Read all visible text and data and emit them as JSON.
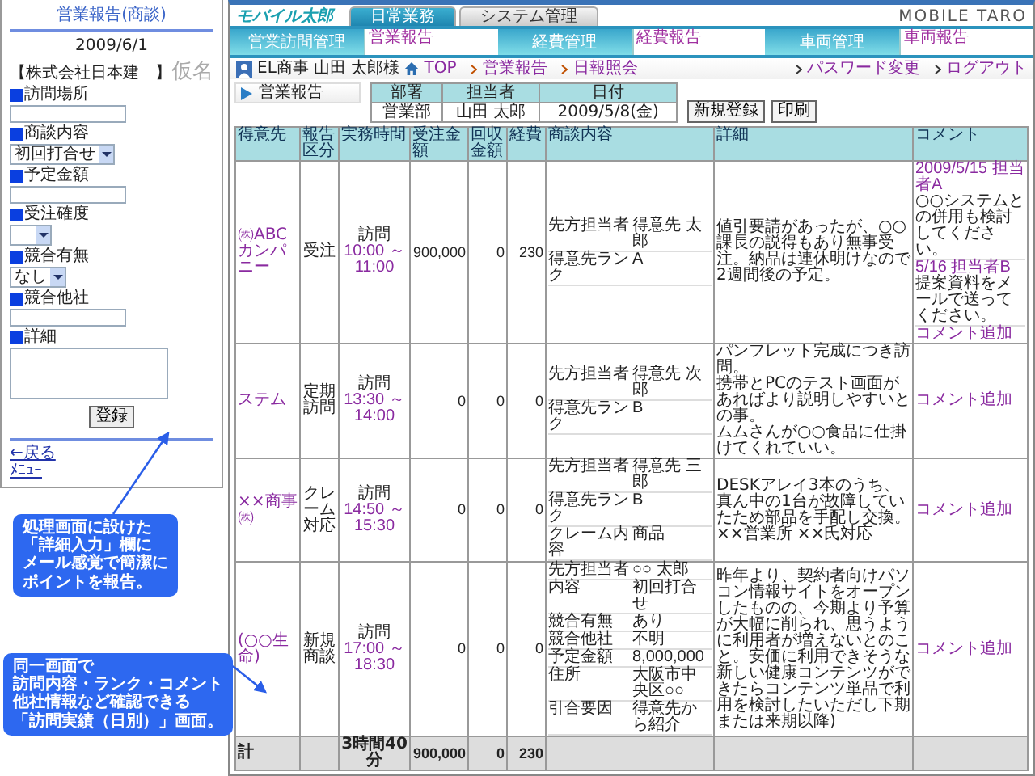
{
  "mobile_form": {
    "title": "営業報告(商談)",
    "date": "2009/6/1",
    "company": "【株式会社日本建　】",
    "kana": "仮名",
    "fields": [
      {
        "label": "訪問場所",
        "kind": "text"
      },
      {
        "label": "商談内容",
        "kind": "select",
        "value": "初回打合せ"
      },
      {
        "label": "予定金額",
        "kind": "text"
      },
      {
        "label": "受注確度",
        "kind": "select"
      },
      {
        "label": "競合有無",
        "kind": "select",
        "value": "なし"
      },
      {
        "label": "競合他社",
        "kind": "text"
      },
      {
        "label": "詳細",
        "kind": "textarea"
      }
    ],
    "submit": "登録",
    "links": [
      "←戻る",
      "ﾒﾆｭｰ"
    ]
  },
  "app": {
    "logo": "モバイル太郎",
    "brand": "MOBILE TARO",
    "tabs": [
      {
        "label": "日常業務",
        "selected": true
      },
      {
        "label": "システム管理",
        "selected": false
      }
    ],
    "menu": [
      {
        "heading": "営業訪問管理",
        "link": "営業報告"
      },
      {
        "heading": "経費管理",
        "link": "経費報告"
      },
      {
        "heading": "車両管理",
        "link": "車両報告"
      }
    ],
    "user": "EL商事 山田 太郎様",
    "top_link": "TOP",
    "account_links": [
      "パスワード変更",
      "ログアウト"
    ],
    "breadcrumb": [
      "営業報告",
      "日報照会"
    ],
    "section_title": "営業報告",
    "info": {
      "columns": [
        "部署",
        "担当者",
        "日付"
      ],
      "row": [
        "営業部",
        "山田 太郎",
        "2009/5/8(金)"
      ]
    },
    "buttons": [
      "新規登録",
      "印刷"
    ],
    "table": {
      "columns": [
        "得意先",
        "報告区分",
        "実務時間",
        "受注金額",
        "回収金額",
        "経費",
        "商談内容",
        "詳細",
        "コメント"
      ],
      "rows": [
        {
          "customer": "㈱ABCカンパニー",
          "type": "受注",
          "visit": "訪問",
          "time": "10:00 ～ 11:00",
          "order": "900,000",
          "collected": "0",
          "expense": "230",
          "pairs": [
            [
              "先方担当者",
              "得意先 太郎"
            ],
            [
              "得意先ランク",
              "A"
            ]
          ],
          "detail": [
            "値引要請があったが、○○課長の説得もあり無事受注。納品は連休明けなので2週間後の予定。"
          ],
          "comments": [
            {
              "date": "2009/5/15 担当者A",
              "text": "○○システムとの併用も検討してください。"
            },
            {
              "date": "5/16 担当者B",
              "text": "提案資料をメールで送ってください。"
            }
          ],
          "add": "コメント追加"
        },
        {
          "customer": "ステム",
          "type": "定期訪問",
          "visit": "訪問",
          "time": "13:30 ～ 14:00",
          "order": "0",
          "collected": "0",
          "expense": "0",
          "pairs": [
            [
              "先方担当者",
              "得意先 次郎"
            ],
            [
              "得意先ランク",
              "B"
            ]
          ],
          "detail": [
            "パンフレット完成につき訪問。",
            "携帯とPCのテスト画面があればより説明しやすいとの事。",
            "ムムさんが○○食品に仕掛けてくれていい。"
          ],
          "comments": [],
          "add": "コメント追加"
        },
        {
          "customer": "××商事㈱",
          "type": "クレーム対応",
          "visit": "訪問",
          "time": "14:50 ～ 15:30",
          "order": "0",
          "collected": "0",
          "expense": "0",
          "pairs": [
            [
              "先方担当者",
              "得意先 三郎"
            ],
            [
              "得意先ランク",
              "B"
            ],
            [
              "クレーム内容",
              "商品"
            ]
          ],
          "detail": [
            "DESKアレイ3本のうち、真ん中の1台が故障していたため部品を手配し交換。",
            "××営業所 ××氏対応"
          ],
          "comments": [],
          "add": "コメント追加"
        },
        {
          "customer": "(○○生命)",
          "type": "新規商談",
          "visit": "訪問",
          "time": "17:00 ～ 18:30",
          "order": "0",
          "collected": "0",
          "expense": "0",
          "pairs": [
            [
              "先方担当者",
              "○○ 太郎"
            ],
            [
              "内容",
              "初回打合せ"
            ],
            [
              "競合有無",
              "あり"
            ],
            [
              "競合他社",
              "不明"
            ],
            [
              "予定金額",
              "8,000,000"
            ],
            [
              "住所",
              "大阪市中央区○○"
            ],
            [
              "引合要因",
              "得意先から紹介"
            ]
          ],
          "detail": [
            "昨年より、契約者向けパソコン情報サイトをオープンしたものの、今期より予算が大幅に削られ、思うように利用者が増えないとのこと。安価に利用できそうな新しい健康コンテンツができたらコンテンツ単品で利用を検討したいただし下期または来期以降)"
          ],
          "comments": [],
          "add": "コメント追加"
        }
      ],
      "total": {
        "label": "計",
        "time": "3時間40分",
        "order": "900,000",
        "collected": "0",
        "expense": "230"
      }
    }
  },
  "callouts": [
    {
      "lines": [
        "処理画面に設けた",
        "「詳細入力」欄に",
        "メール感覚で簡潔に",
        "ポイントを報告。"
      ]
    },
    {
      "lines": [
        "同一画面で",
        "訪問内容・ランク・コメント",
        "他社情報など確認できる",
        "「訪問実績（日別）」画面。"
      ]
    }
  ]
}
